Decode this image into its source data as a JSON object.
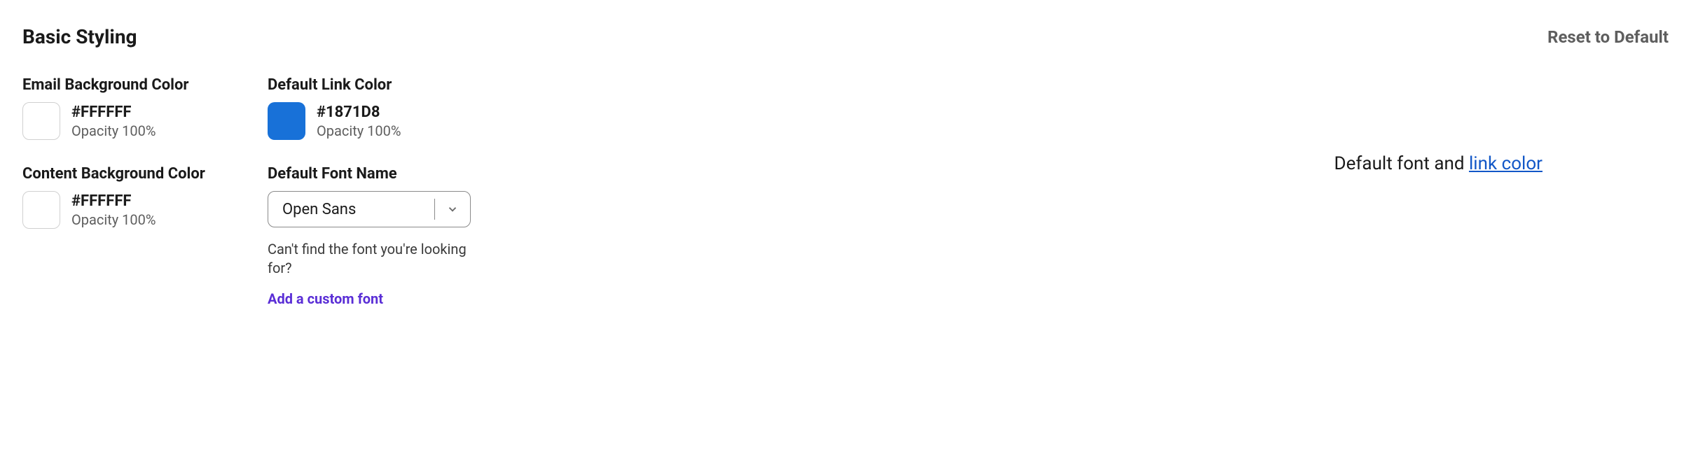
{
  "header": {
    "title": "Basic Styling",
    "reset_label": "Reset to Default"
  },
  "fields": {
    "email_bg": {
      "label": "Email Background Color",
      "hex": "#FFFFFF",
      "opacity": "Opacity 100%",
      "swatch_color": "#FFFFFF"
    },
    "link_color": {
      "label": "Default Link Color",
      "hex": "#1871D8",
      "opacity": "Opacity 100%",
      "swatch_color": "#1871D8"
    },
    "content_bg": {
      "label": "Content Background Color",
      "hex": "#FFFFFF",
      "opacity": "Opacity 100%",
      "swatch_color": "#FFFFFF"
    },
    "font_name": {
      "label": "Default Font Name",
      "value": "Open Sans",
      "helper": "Can't find the font you're looking for?",
      "custom_link": "Add a custom font"
    }
  },
  "preview": {
    "text_prefix": "Default font and ",
    "link_text": "link color"
  }
}
